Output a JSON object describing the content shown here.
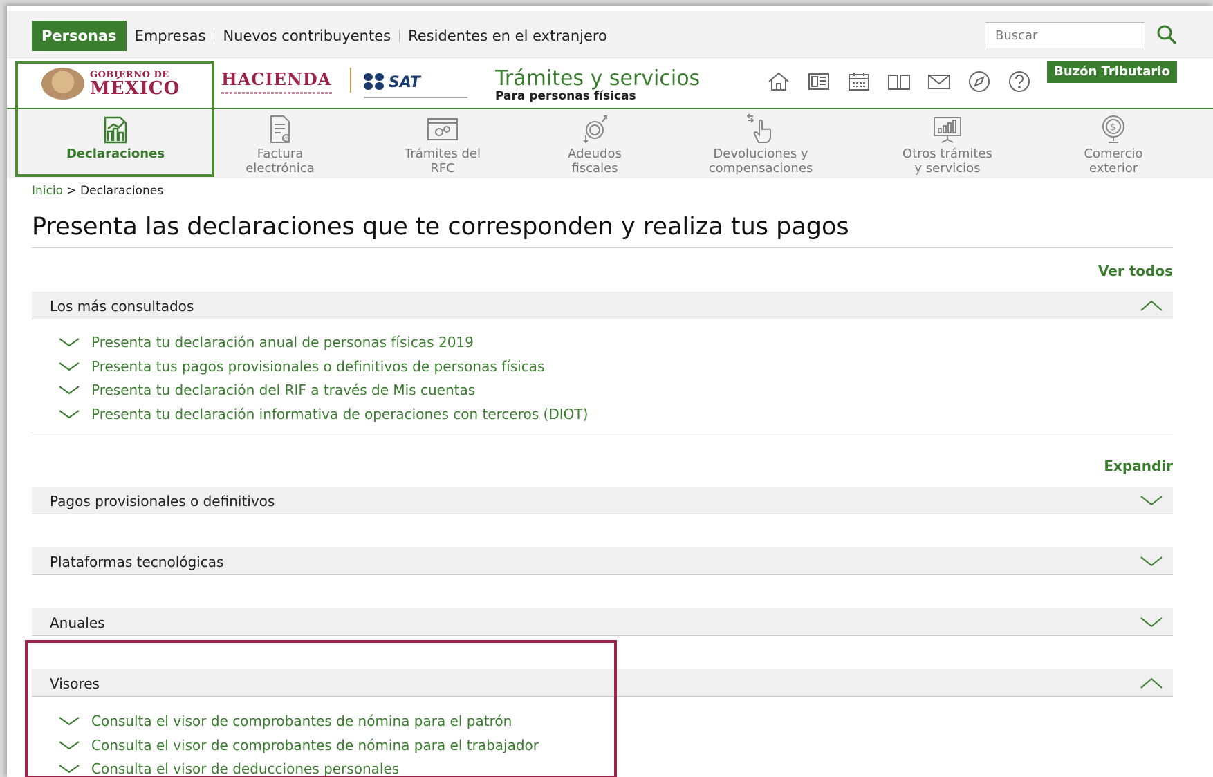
{
  "audience_tabs": [
    "Personas",
    "Empresas",
    "Nuevos contribuyentes",
    "Residentes en el extranjero"
  ],
  "search": {
    "placeholder": "Buscar"
  },
  "logos": {
    "gobierno_small": "GOBIERNO DE",
    "gobierno_big": "MÉXICO",
    "hacienda": "HACIENDA",
    "sat": "SAT"
  },
  "site": {
    "title": "Trámites y servicios",
    "subtitle": "Para personas físicas"
  },
  "utility_icons": [
    "home-icon",
    "newspaper-icon",
    "calendar-icon",
    "book-icon",
    "mail-icon",
    "compass-icon",
    "help-icon"
  ],
  "buzon_label": "Buzón Tributario",
  "nav": [
    {
      "line1": "Declaraciones",
      "line2": "",
      "icon": "declaraciones-icon"
    },
    {
      "line1": "Factura",
      "line2": "electrónica",
      "icon": "factura-icon"
    },
    {
      "line1": "Trámites del",
      "line2": "RFC",
      "icon": "rfc-icon"
    },
    {
      "line1": "Adeudos",
      "line2": "fiscales",
      "icon": "adeudos-icon"
    },
    {
      "line1": "Devoluciones y",
      "line2": "compensaciones",
      "icon": "devoluciones-icon"
    },
    {
      "line1": "Otros trámites",
      "line2": "y servicios",
      "icon": "otros-icon"
    },
    {
      "line1": "Comercio",
      "line2": "exterior",
      "icon": "comercio-icon"
    }
  ],
  "breadcrumb": {
    "home": "Inicio",
    "separator": ">",
    "current": "Declaraciones"
  },
  "page_title": "Presenta las declaraciones que te corresponden y realiza tus pagos",
  "ver_todos": "Ver todos",
  "expandir": "Expandir",
  "mas_consultados": {
    "title": "Los más consultados",
    "items": [
      "Presenta tu declaración anual de personas físicas 2019",
      "Presenta tus pagos provisionales o definitivos de personas físicas",
      "Presenta tu declaración del RIF a través de Mis cuentas",
      "Presenta tu declaración informativa de operaciones con terceros (DIOT)"
    ]
  },
  "sections": {
    "pagos": "Pagos provisionales o definitivos",
    "plataformas": "Plataformas tecnológicas",
    "anuales": "Anuales",
    "visores": {
      "title": "Visores",
      "items": [
        "Consulta el visor de comprobantes de nómina para el patrón",
        "Consulta el visor de comprobantes de nómina para el trabajador",
        "Consulta el visor de deducciones personales"
      ]
    }
  },
  "colors": {
    "brand_green": "#3a7d2f",
    "brand_wine": "#9d2449"
  }
}
